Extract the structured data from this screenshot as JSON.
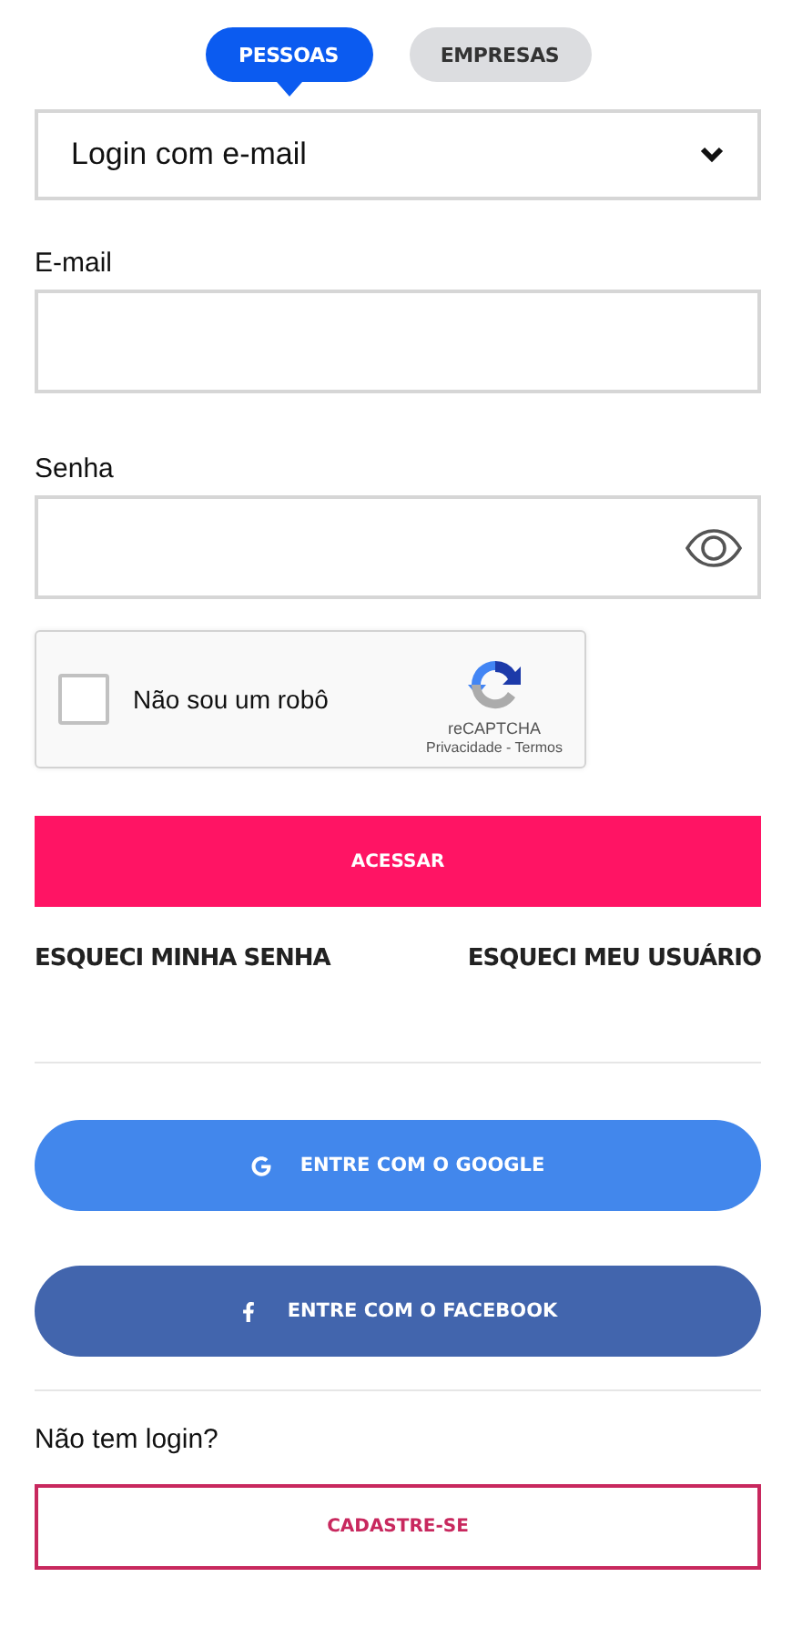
{
  "tabs": [
    {
      "label": "PESSOAS",
      "selected": true
    },
    {
      "label": "EMPRESAS",
      "selected": false
    }
  ],
  "login_method": {
    "value": "Login com e-mail"
  },
  "fields": [
    {
      "label": "E-mail",
      "kind": "text"
    },
    {
      "label": "Senha",
      "kind": "password"
    }
  ],
  "captcha": {
    "label": "Não sou um robô",
    "checked": false,
    "brand": "reCAPTCHA",
    "links": "Privacidade - Termos"
  },
  "submit": "ACESSAR",
  "links": [
    "ESQUECI MINHA SENHA",
    "ESQUECI MEU USUÁRIO"
  ],
  "social": [
    {
      "kind": "google",
      "label": "ENTRE COM O GOOGLE",
      "color": "#4287ec"
    },
    {
      "kind": "facebook",
      "label": "ENTRE COM O FACEBOOK",
      "color": "#4265ad"
    }
  ],
  "signup": {
    "prompt": "Não tem login?",
    "button": "CADASTRE-SE"
  }
}
